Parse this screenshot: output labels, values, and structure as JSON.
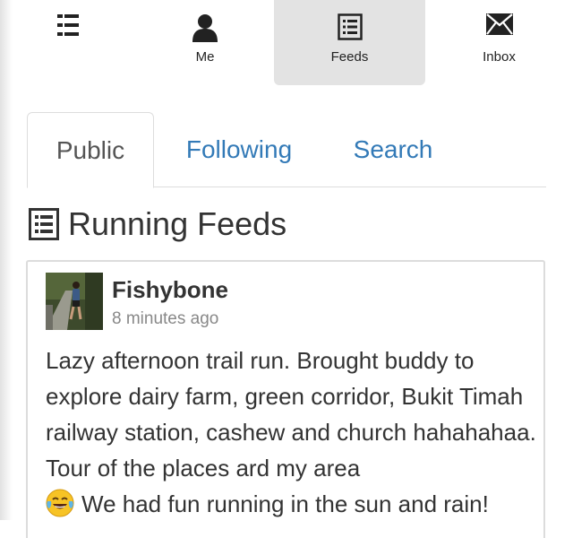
{
  "nav": {
    "menu_icon": "hamburger-menu-icon",
    "items": [
      {
        "label": "Me",
        "icon": "user-icon"
      },
      {
        "label": "Feeds",
        "icon": "list-icon"
      },
      {
        "label": "Inbox",
        "icon": "envelope-icon"
      }
    ],
    "active": "Feeds",
    "active_bg": "#e3e3e3"
  },
  "tabs": [
    {
      "label": "Public",
      "active": true
    },
    {
      "label": "Following",
      "active": false
    },
    {
      "label": "Search",
      "active": false
    }
  ],
  "heading": {
    "icon": "list-icon",
    "title": "Running Feeds"
  },
  "post": {
    "author": "Fishybone",
    "time": "8 minutes ago",
    "body_text": "Lazy afternoon trail run. Brought buddy to explore dairy farm, green corridor, Bukit Timah railway station, cashew and church hahahahaa. Tour of the places ard my area",
    "body_emoji": "face-with-tears-of-joy",
    "body_text_2": "We had fun running in the sun and rain!"
  },
  "colors": {
    "link": "#337ab7",
    "text": "#333333",
    "muted": "#888888",
    "border": "#dddddd"
  }
}
